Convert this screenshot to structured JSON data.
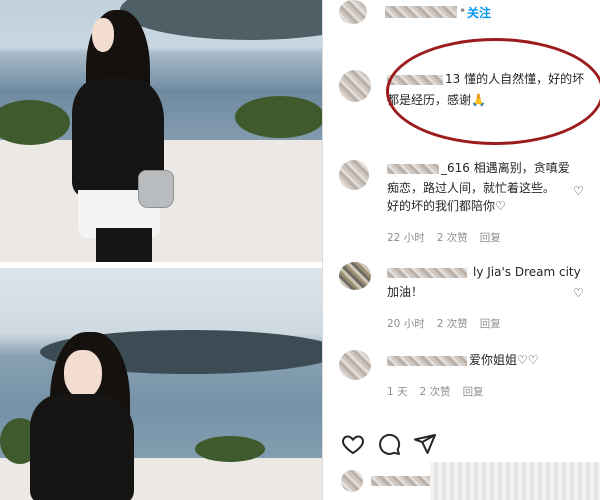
{
  "header": {
    "follow_label": "关注",
    "follow_dot": "•"
  },
  "comments": [
    {
      "text_line1": "13 懂的人自然懂，好的坏",
      "text_line2": "都是经历，感谢🙏"
    },
    {
      "text_line1": "_616 相遇离别，贪嗔爱",
      "text_line2": "痴恋，路过人间，就忙着这些。",
      "text_line3": "好的坏的我们都陪你♡",
      "time": "22 小时",
      "likes": "2 次赞",
      "reply": "回复"
    },
    {
      "text_line1": "ly Jia's Dream city",
      "text_line2": "加油！",
      "time": "20 小时",
      "likes": "2 次赞",
      "reply": "回复"
    },
    {
      "text_line1": "爱你姐姐♡♡",
      "time": "1 天",
      "likes": "2 次赞",
      "reply": "回复"
    }
  ],
  "actions": {
    "like_icon": "heart-icon",
    "comment_icon": "comment-icon",
    "share_icon": "share-icon"
  },
  "colors": {
    "follow_blue": "#0095f6",
    "highlight_circle": "#9b1c1c",
    "meta_gray": "#8e8e8e"
  }
}
